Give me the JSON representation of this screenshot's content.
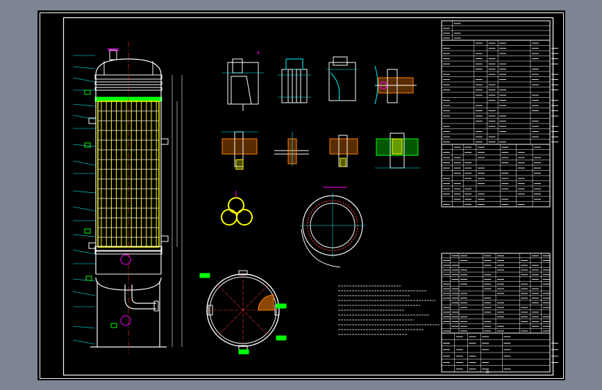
{
  "colors": {
    "background": "#7d8593",
    "sheet": "#000000",
    "frame": "#ffffff",
    "cyan": "#00ffff",
    "yellow": "#ffff00",
    "magenta": "#ff00ff",
    "green": "#00ff00",
    "red": "#ff3030",
    "orange": "#ff7f00"
  },
  "labels": {
    "rev_mark": "B"
  }
}
